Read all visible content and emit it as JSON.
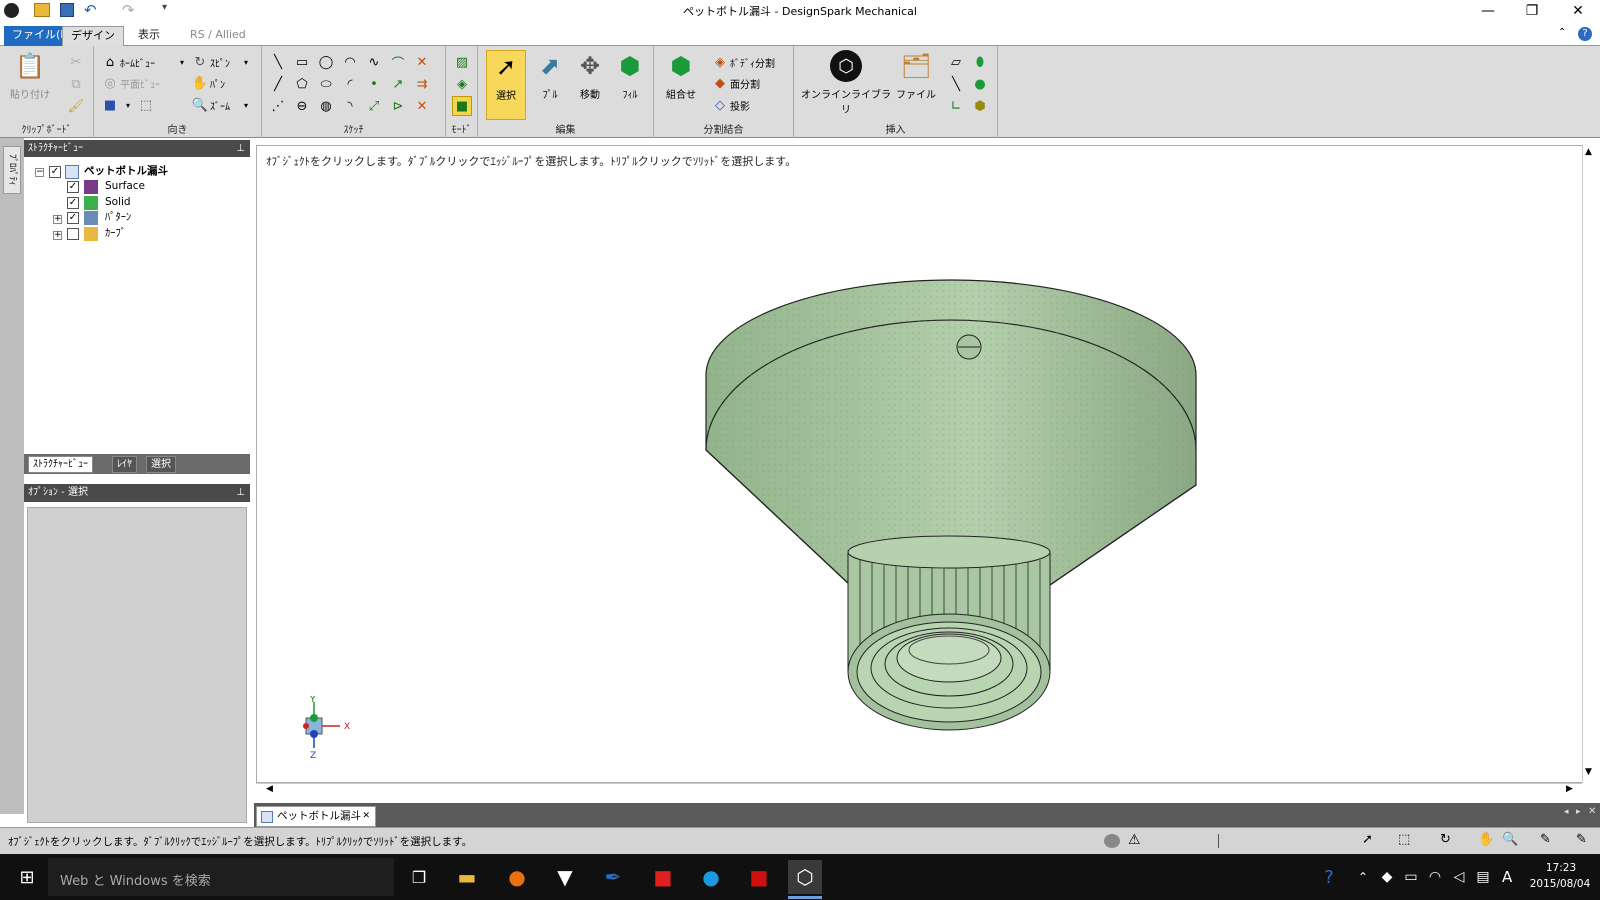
{
  "window": {
    "title": "ペットボトル漏斗 - DesignSpark Mechanical",
    "minimize": "—",
    "restore": "❐",
    "close": "✕"
  },
  "quick_access": {
    "undo": "↶",
    "redo": "↷"
  },
  "tabs": [
    {
      "label": "ファイル(F)"
    },
    {
      "label": "デザイン"
    },
    {
      "label": "表示"
    },
    {
      "label": "RS / Allied"
    }
  ],
  "ribbon": {
    "clipboard": {
      "label": "ｸﾘｯﾌﾟﾎﾞｰﾄﾞ",
      "paste": "貼り付け"
    },
    "orient": {
      "label": "向き",
      "home_view": "ﾎｰﾑﾋﾞｭｰ",
      "plane_view": "平面ﾋﾞｭｰ",
      "spin": "ｽﾋﾟﾝ",
      "pan": "ﾊﾟﾝ",
      "zoom": "ｽﾞｰﾑ"
    },
    "sketch": {
      "label": "ｽｹｯﾁ"
    },
    "mode": {
      "label": "ﾓｰﾄﾞ"
    },
    "edit": {
      "label": "編集",
      "select": "選択",
      "pull": "ﾌﾟﾙ",
      "move": "移動",
      "fill": "ﾌｨﾙ"
    },
    "intersect": {
      "label": "分割結合",
      "combine": "組合せ",
      "split_body": "ﾎﾞﾃﾞｨ分割",
      "split_face": "面分割",
      "project": "投影"
    },
    "insert": {
      "label": "挿入",
      "online_library": "オンラインライブラリ",
      "file": "ファイル"
    }
  },
  "side_tab": "ﾌﾟﾛﾊﾟﾃｨ",
  "structure": {
    "header": "ｽﾄﾗｸﾁｬｰﾋﾞｭｰ",
    "items": [
      {
        "label": "ペットボトル漏斗",
        "checked": true
      },
      {
        "label": "Surface",
        "checked": true
      },
      {
        "label": "Solid",
        "checked": true
      },
      {
        "label": "ﾊﾟﾀｰﾝ",
        "checked": true
      },
      {
        "label": "ｶｰﾌﾞ",
        "checked": false
      }
    ],
    "check_mark": "✓",
    "expand_minus": "−",
    "expand_plus": "+"
  },
  "panel_tabs": [
    "ｽﾄﾗｸﾁｬｰﾋﾞｭｰ",
    "ﾚｲﾔ",
    "選択"
  ],
  "options": {
    "header": "ｵﾌﾟｼｮﾝ - 選択"
  },
  "viewport": {
    "hint": "ｵﾌﾞｼﾞｪｸﾄをクリックします。ﾀﾞﾌﾞﾙクリックでｴｯｼﾞﾙｰﾌﾟを選択します。ﾄﾘﾌﾟﾙクリックでｿﾘｯﾄﾞを選択します。",
    "axis_x": "X",
    "axis_y": "Y",
    "axis_z": "Z",
    "model_color": "#9dbf96"
  },
  "doc_tab": {
    "label": "ペットボトル漏斗",
    "close": "✕"
  },
  "status": {
    "text": "ｵﾌﾞｼﾞｪｸﾄをクリックします。ﾀﾞﾌﾞﾙｸﾘｯｸでｴｯｼﾞﾙｰﾌﾟを選択します。ﾄﾘﾌﾟﾙｸﾘｯｸでｿﾘｯﾄﾞを選択します。"
  },
  "taskbar": {
    "search_placeholder": "Web と Windows を検索",
    "time": "17:23",
    "date": "2015/08/04",
    "ime": "A"
  }
}
